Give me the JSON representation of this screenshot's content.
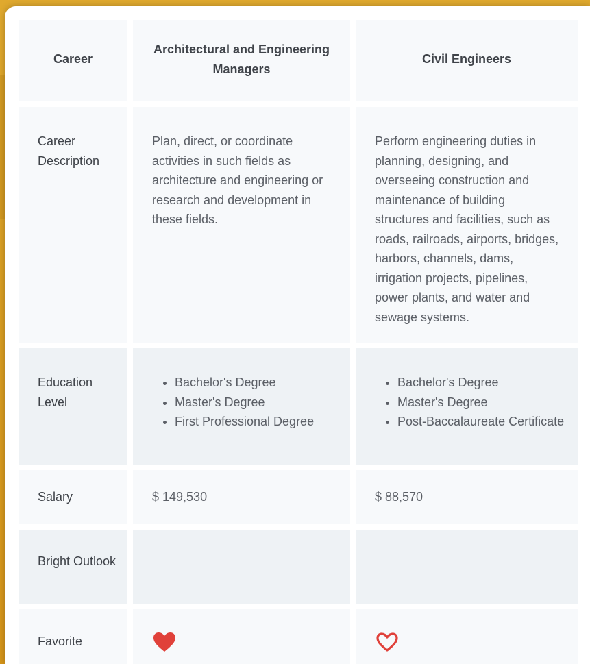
{
  "close_icon": "close-icon",
  "accent_color": "#1e6fb5",
  "heart_color": "#e0413a",
  "table": {
    "header": {
      "label": "Career",
      "careers": [
        "Architectural and Engineering Managers",
        "Civil Engineers"
      ]
    },
    "description": {
      "label": "Career Description",
      "values": [
        "Plan, direct, or coordinate activities in such fields as architecture and engineering or research and development in these fields.",
        "Perform engineering duties in planning, designing, and overseeing construction and maintenance of building structures and facilities, such as roads, railroads, airports, bridges, harbors, channels, dams, irrigation projects, pipelines, power plants, and water and sewage systems."
      ]
    },
    "education": {
      "label": "Education Level",
      "values": [
        [
          "Bachelor's Degree",
          "Master's Degree",
          "First Professional Degree"
        ],
        [
          "Bachelor's Degree",
          "Master's Degree",
          "Post-Baccalaureate Certificate"
        ]
      ]
    },
    "salary": {
      "label": "Salary",
      "values": [
        "$ 149,530",
        "$ 88,570"
      ]
    },
    "bright_outlook": {
      "label": "Bright Outlook",
      "values": [
        "",
        ""
      ]
    },
    "favorite": {
      "label": "Favorite",
      "values": [
        {
          "icon": "heart-filled-icon",
          "favorited": true
        },
        {
          "icon": "heart-outline-icon",
          "favorited": false
        }
      ]
    }
  }
}
